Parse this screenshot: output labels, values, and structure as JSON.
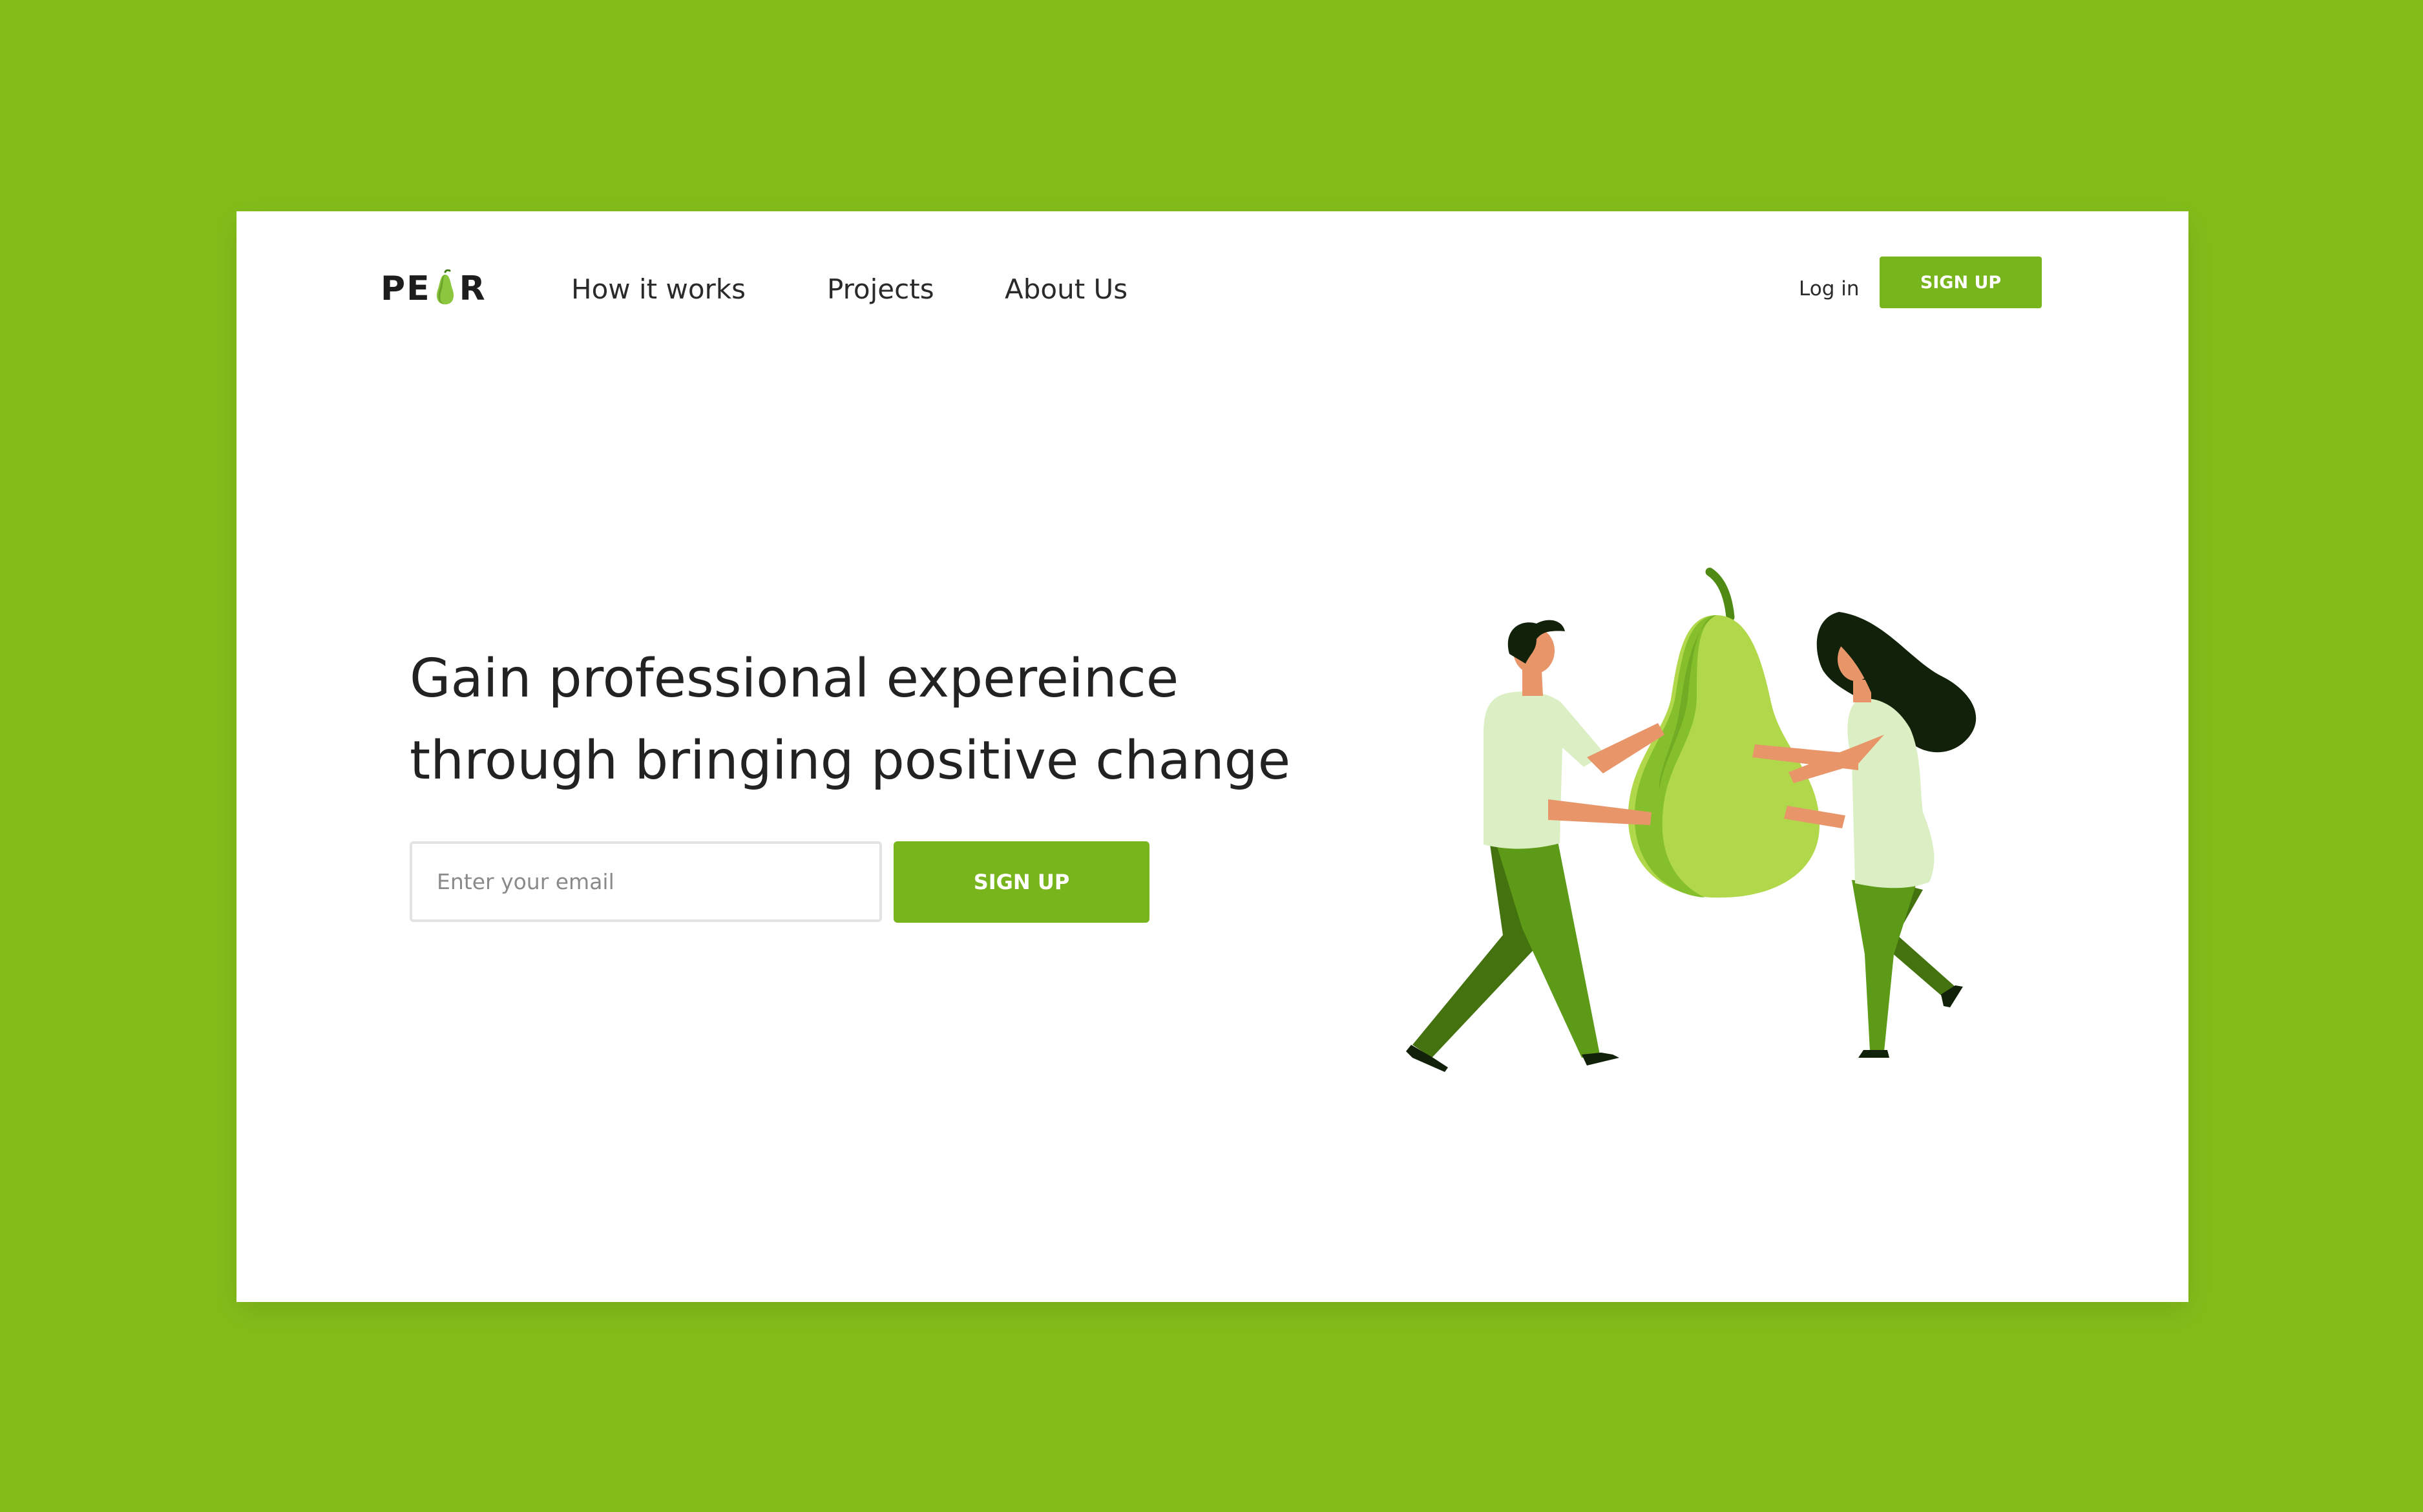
{
  "brand": {
    "logo_before": "PE",
    "logo_after": "R",
    "logo_icon": "pear-icon"
  },
  "nav": {
    "items": [
      {
        "label": "How it works"
      },
      {
        "label": "Projects"
      },
      {
        "label": "About Us"
      }
    ],
    "login_label": "Log in",
    "signup_label": "SIGN UP"
  },
  "hero": {
    "headline_line1": "Gain professional expereince",
    "headline_line2": "through bringing positive change",
    "email_placeholder": "Enter your email",
    "signup_label": "SIGN UP",
    "illustration": "people-carrying-pear-illustration"
  },
  "colors": {
    "background": "#84bd1a",
    "accent": "#78b41c",
    "card": "#ffffff",
    "text": "#222222"
  }
}
